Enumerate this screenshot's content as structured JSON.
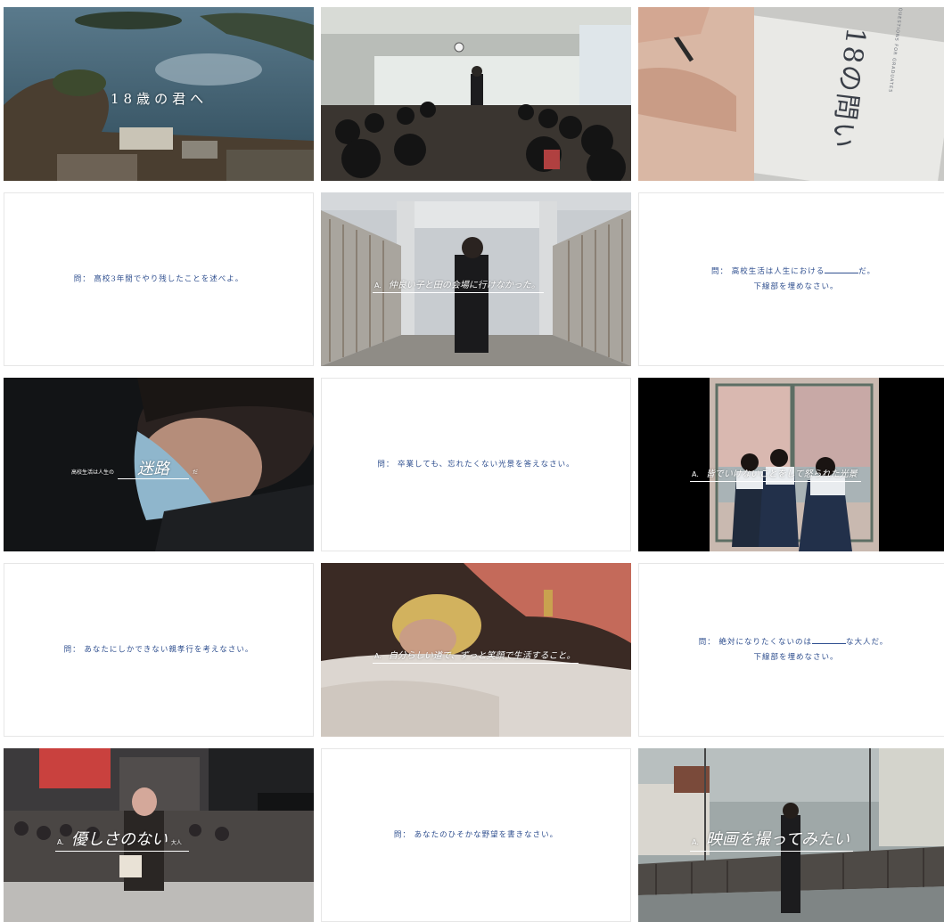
{
  "frames": [
    {
      "title": "18歳の君へ"
    },
    {},
    {
      "book_title": "18の問い",
      "book_subtitle": "18 QUESTIONS FOR GRADUATES"
    },
    {
      "question": "問： 高校3年間でやり残したことを述べよ。"
    },
    {
      "answer_prefix": "A.",
      "answer": "仲良い子と田の会場に行けなかった。"
    },
    {
      "question_line1": "問： 高校生活は人生における",
      "question_line1_end": "だ。",
      "question_line2": "下線部を埋めなさい。"
    },
    {
      "prefix": "高校生活は人生の",
      "answer": "迷路",
      "suffix": "だ"
    },
    {
      "question": "問： 卒業しても、忘れたくない光景を答えなさい。"
    },
    {
      "answer_prefix": "A.",
      "answer": "皆でいけないことをして怒られた光景"
    },
    {
      "question": "問： あなたにしかできない親孝行を考えなさい。"
    },
    {
      "answer_prefix": "A.",
      "answer": "自分らしい道で、ずっと笑顔で生活すること。"
    },
    {
      "question_line1": "問： 絶対になりたくないのは",
      "question_line1_end": "な大人だ。",
      "question_line2": "下線部を埋めなさい。"
    },
    {
      "answer_prefix": "A.",
      "answer": "優しさのない",
      "suffix": "大人"
    },
    {
      "question": "問： あなたのひそかな野望を書きなさい。"
    },
    {
      "answer_prefix": "A.",
      "answer": "映画を撮ってみたい"
    }
  ]
}
